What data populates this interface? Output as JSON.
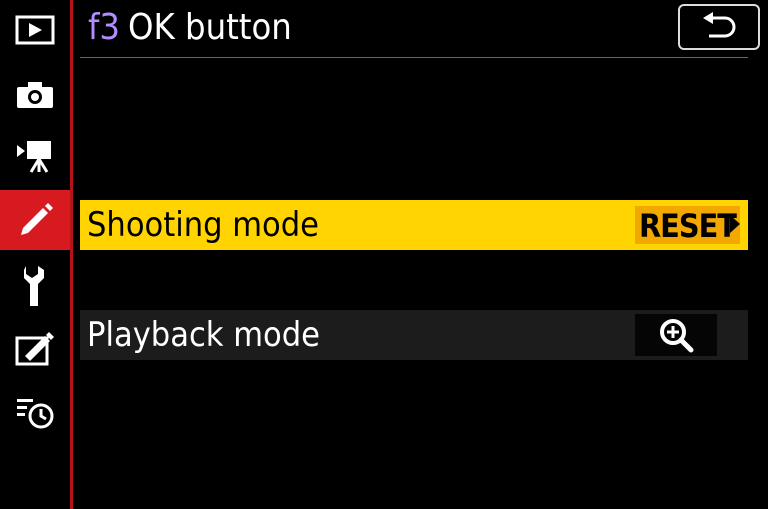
{
  "sidebar": {
    "items": [
      {
        "icon": "playback-icon",
        "active": false
      },
      {
        "icon": "photo-shooting-icon",
        "active": false
      },
      {
        "icon": "movie-recording-icon",
        "active": false
      },
      {
        "icon": "custom-settings-pencil-icon",
        "active": true
      },
      {
        "icon": "setup-wrench-icon",
        "active": false
      },
      {
        "icon": "retouch-icon",
        "active": false
      },
      {
        "icon": "recent-settings-icon",
        "active": false
      }
    ]
  },
  "header": {
    "menu_code": "f3",
    "title": "OK button",
    "back_icon": "back-arrow-icon"
  },
  "rows": [
    {
      "label": "Shooting mode",
      "value": "RESET",
      "selected": true
    },
    {
      "label": "Playback mode",
      "value_icon": "zoom-in-icon",
      "selected": false
    }
  ],
  "colors": {
    "active_tab": "#d71920",
    "highlight": "#ffd400",
    "value_highlight": "#f2a800",
    "menu_code": "#b38cff"
  }
}
